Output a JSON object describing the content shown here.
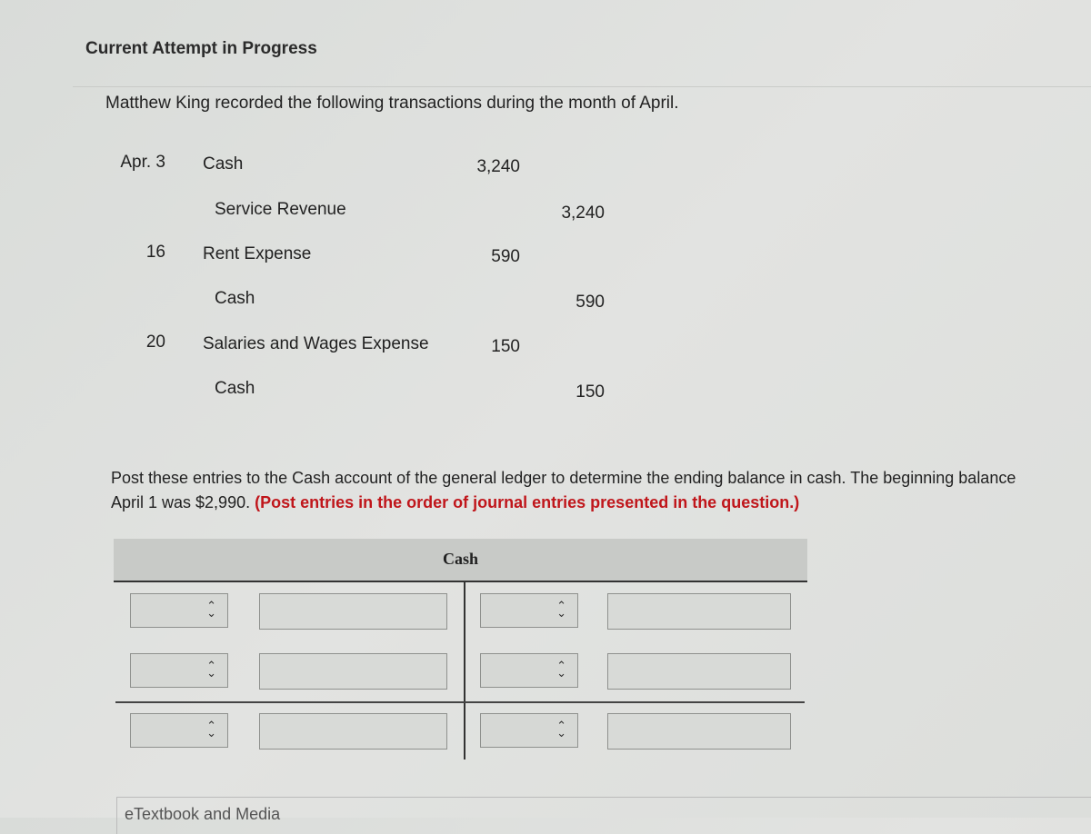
{
  "header": {
    "title": "Current Attempt in Progress"
  },
  "question": {
    "intro": "Matthew King recorded the following transactions during the month of April.",
    "journal": [
      {
        "date": "Apr. 3",
        "account": "Cash",
        "debit": "3,240",
        "credit": ""
      },
      {
        "date": "",
        "account": "Service Revenue",
        "debit": "",
        "credit": "3,240"
      },
      {
        "date": "16",
        "account": "Rent Expense",
        "debit": "590",
        "credit": ""
      },
      {
        "date": "",
        "account": "Cash",
        "debit": "",
        "credit": "590"
      },
      {
        "date": "20",
        "account": "Salaries and Wages Expense",
        "debit": "150",
        "credit": ""
      },
      {
        "date": "",
        "account": "Cash",
        "debit": "",
        "credit": "150"
      }
    ],
    "instruction": "Post these entries to the Cash account of the general ledger to determine the ending balance in cash. The beginning balance",
    "instruction_line2": "April 1 was $2,990.",
    "instruction_note": "(Post entries in the order of journal entries presented in the question.)"
  },
  "t_account": {
    "title": "Cash"
  },
  "footer": {
    "link": "eTextbook and Media"
  },
  "colors": {
    "note_red": "#c0161b",
    "header_bg": "#c8cac7"
  }
}
